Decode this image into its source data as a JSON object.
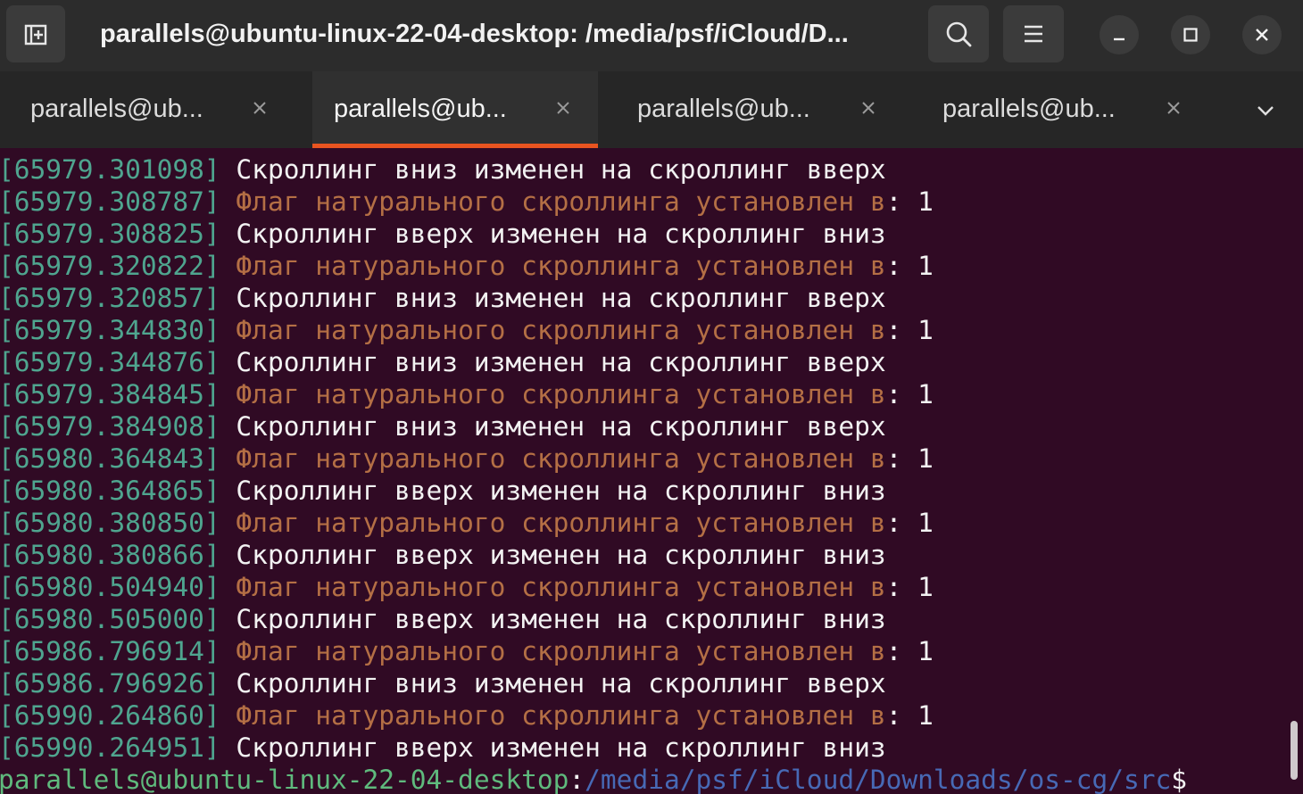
{
  "window": {
    "title": "parallels@ubuntu-linux-22-04-desktop: /media/psf/iCloud/D..."
  },
  "tabs": [
    {
      "label": "parallels@ub...",
      "active": false
    },
    {
      "label": "parallels@ub...",
      "active": true
    },
    {
      "label": "parallels@ub...",
      "active": false
    },
    {
      "label": "parallels@ub...",
      "active": false
    }
  ],
  "colors": {
    "accent": "#e95420",
    "timestamp": "#4fa58f",
    "flag_text": "#b46f45",
    "background": "#300a24"
  },
  "icons": {
    "new_tab": "new-tab-icon",
    "search": "search-icon",
    "menu": "hamburger-menu-icon",
    "minimize": "minimize-icon",
    "maximize": "maximize-icon",
    "close": "close-icon",
    "tab_close": "close-icon",
    "tabs_overflow": "chevron-down-icon"
  },
  "terminal": {
    "lines": [
      {
        "ts": "[65979.301098]",
        "msg": " Скроллинг вниз изменен на скроллинг вверх",
        "kind": "w",
        "val": ""
      },
      {
        "ts": "[65979.308787]",
        "msg": " Флаг натурального скроллинга установлен в",
        "kind": "o",
        "val": ": 1"
      },
      {
        "ts": "[65979.308825]",
        "msg": " Скроллинг вверх изменен на скроллинг вниз",
        "kind": "w",
        "val": ""
      },
      {
        "ts": "[65979.320822]",
        "msg": " Флаг натурального скроллинга установлен в",
        "kind": "o",
        "val": ": 1"
      },
      {
        "ts": "[65979.320857]",
        "msg": " Скроллинг вниз изменен на скроллинг вверх",
        "kind": "w",
        "val": ""
      },
      {
        "ts": "[65979.344830]",
        "msg": " Флаг натурального скроллинга установлен в",
        "kind": "o",
        "val": ": 1"
      },
      {
        "ts": "[65979.344876]",
        "msg": " Скроллинг вниз изменен на скроллинг вверх",
        "kind": "w",
        "val": ""
      },
      {
        "ts": "[65979.384845]",
        "msg": " Флаг натурального скроллинга установлен в",
        "kind": "o",
        "val": ": 1"
      },
      {
        "ts": "[65979.384908]",
        "msg": " Скроллинг вниз изменен на скроллинг вверх",
        "kind": "w",
        "val": ""
      },
      {
        "ts": "[65980.364843]",
        "msg": " Флаг натурального скроллинга установлен в",
        "kind": "o",
        "val": ": 1"
      },
      {
        "ts": "[65980.364865]",
        "msg": " Скроллинг вверх изменен на скроллинг вниз",
        "kind": "w",
        "val": ""
      },
      {
        "ts": "[65980.380850]",
        "msg": " Флаг натурального скроллинга установлен в",
        "kind": "o",
        "val": ": 1"
      },
      {
        "ts": "[65980.380866]",
        "msg": " Скроллинг вверх изменен на скроллинг вниз",
        "kind": "w",
        "val": ""
      },
      {
        "ts": "[65980.504940]",
        "msg": " Флаг натурального скроллинга установлен в",
        "kind": "o",
        "val": ": 1"
      },
      {
        "ts": "[65980.505000]",
        "msg": " Скроллинг вверх изменен на скроллинг вниз",
        "kind": "w",
        "val": ""
      },
      {
        "ts": "[65986.796914]",
        "msg": " Флаг натурального скроллинга установлен в",
        "kind": "o",
        "val": ": 1"
      },
      {
        "ts": "[65986.796926]",
        "msg": " Скроллинг вниз изменен на скроллинг вверх",
        "kind": "w",
        "val": ""
      },
      {
        "ts": "[65990.264860]",
        "msg": " Флаг натурального скроллинга установлен в",
        "kind": "o",
        "val": ": 1"
      },
      {
        "ts": "[65990.264951]",
        "msg": " Скроллинг вверх изменен на скроллинг вниз",
        "kind": "w",
        "val": ""
      }
    ],
    "prompt": {
      "user_host": "parallels@ubuntu-linux-22-04-desktop",
      "sep": ":",
      "path": "/media/psf/iCloud/Downloads/os-cg/src",
      "dollar": "$"
    }
  }
}
